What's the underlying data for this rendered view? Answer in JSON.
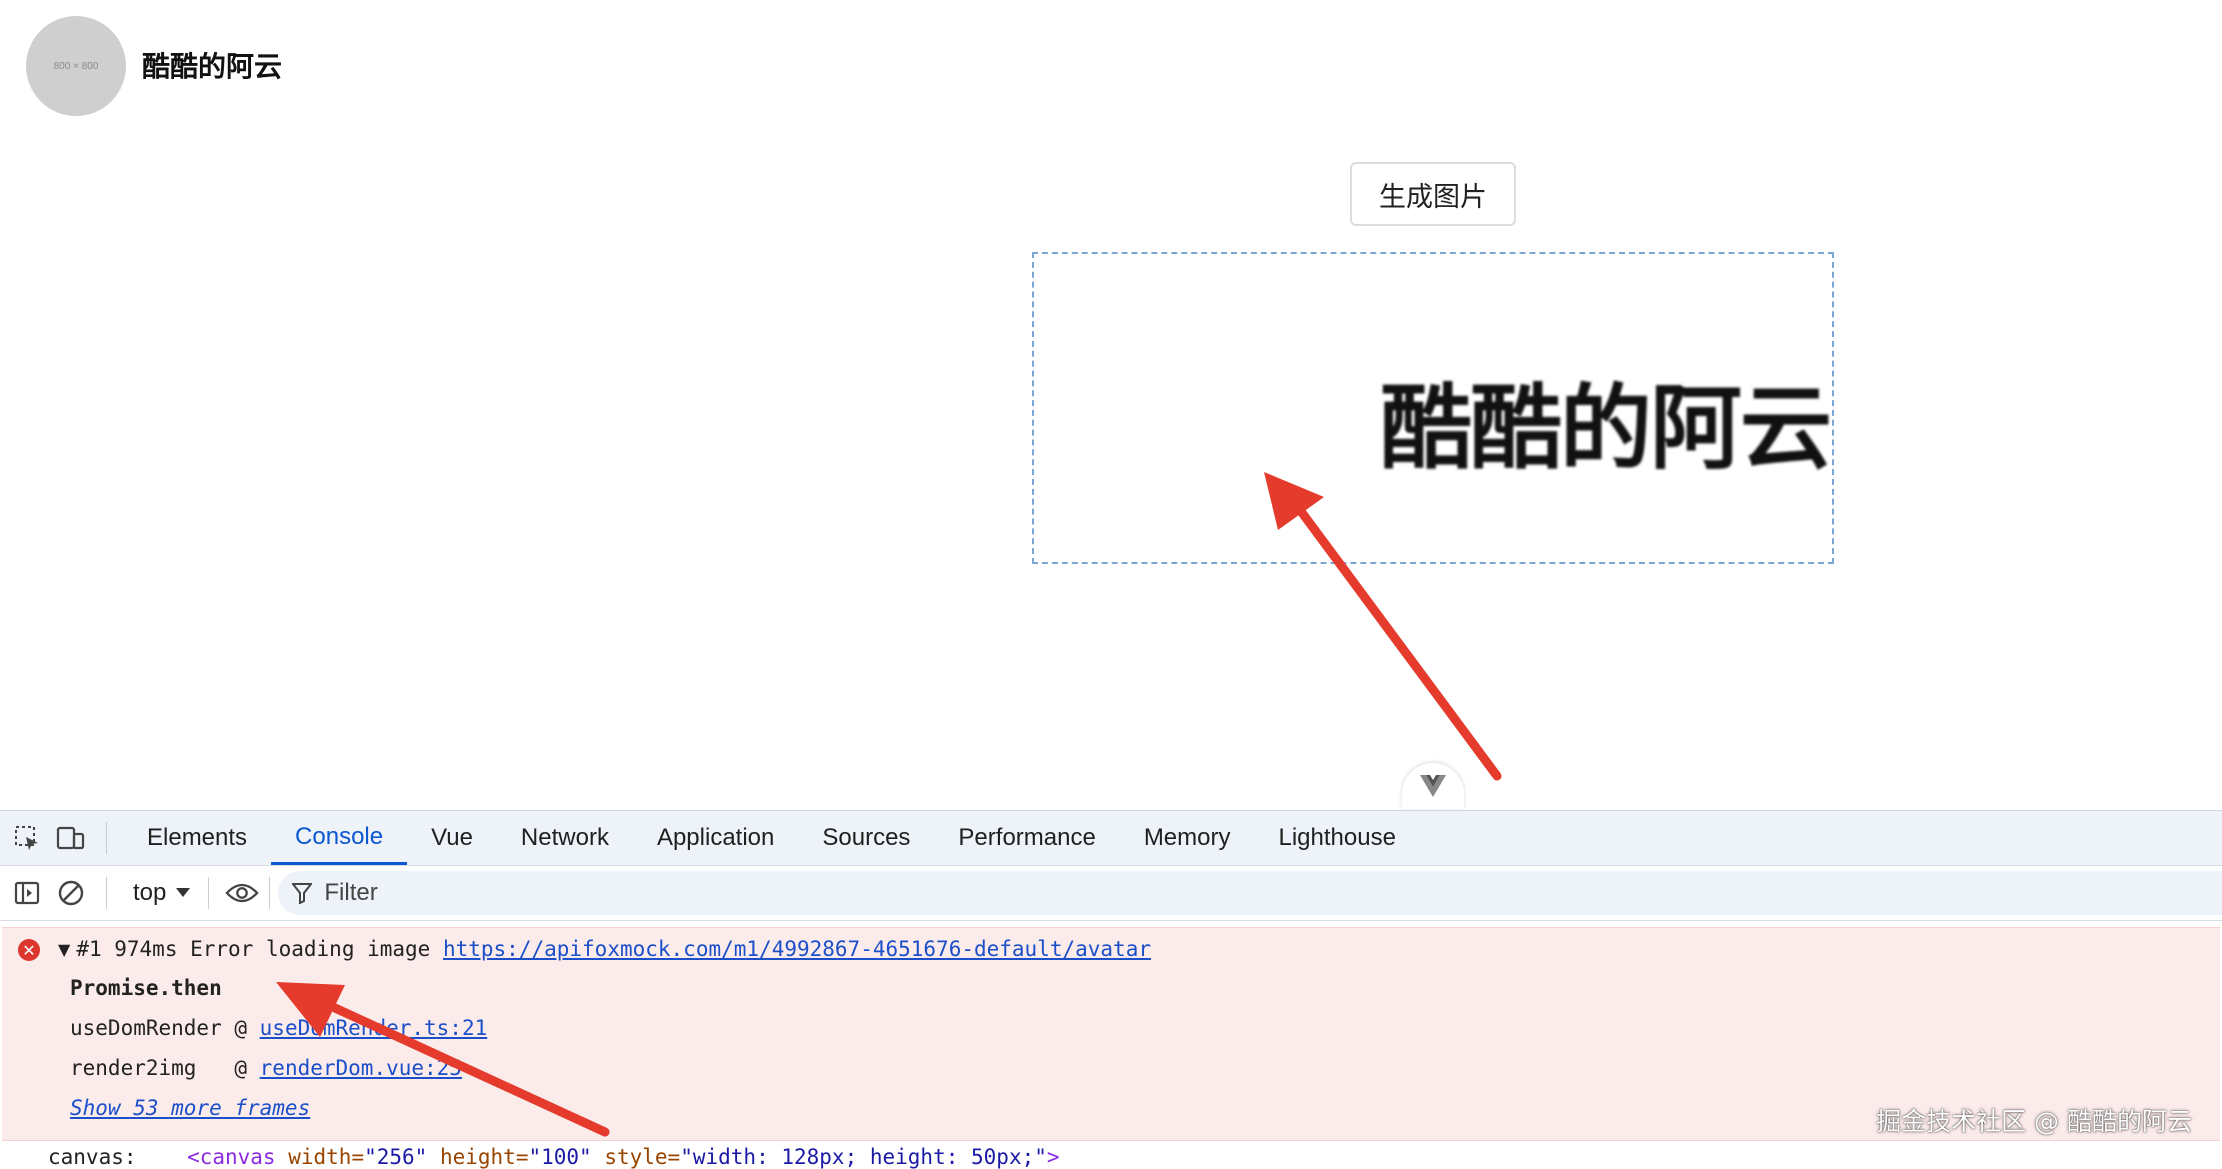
{
  "page": {
    "avatar_placeholder": "800 × 800",
    "username": "酷酷的阿云",
    "generate_button": "生成图片",
    "preview_text": "酷酷的阿云"
  },
  "devtools": {
    "tabs": [
      "Elements",
      "Console",
      "Vue",
      "Network",
      "Application",
      "Sources",
      "Performance",
      "Memory",
      "Lighthouse"
    ],
    "active_tab": "Console",
    "context": "top",
    "filter_placeholder": "Filter",
    "error": {
      "prefix": "#1 974ms Error loading image ",
      "url": "https://apifoxmock.com/m1/4992867-4651676-default/avatar",
      "stack_title": "Promise.then",
      "frames": [
        {
          "fn": "useDomRender @ ",
          "loc": "useDomRender.ts:21"
        },
        {
          "fn": "render2img   @ ",
          "loc": "renderDom.vue:25"
        }
      ],
      "more_frames": "Show 53 more frames"
    },
    "canvas_log": {
      "label": "canvas:    ",
      "open": "<canvas",
      "a1": " width=",
      "v1": "\"256\"",
      "a2": " height=",
      "v2": "\"100\"",
      "a3": " style=",
      "v3": "\"width: 128px; height: 50px;\"",
      "close": ">"
    }
  },
  "colors": {
    "accent": "#0b57d0",
    "error_bg": "#fcebeb",
    "arrow": "#e53b2c"
  },
  "watermark": "掘金技术社区 @ 酷酷的阿云"
}
